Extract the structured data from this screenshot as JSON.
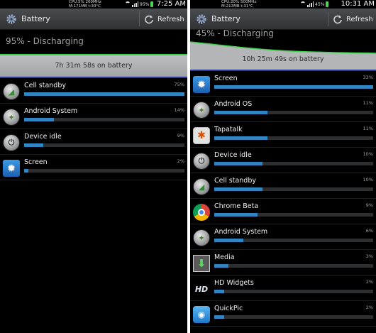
{
  "left": {
    "status": {
      "cpu_line1": "CPU:5% 200MHz",
      "cpu_line2": "M:171MB t:30°C",
      "battery_text": "95%",
      "time": "7:25 AM"
    },
    "actionbar": {
      "title": "Battery",
      "refresh_label": "Refresh"
    },
    "summary": "95% - Discharging",
    "graph_label": "7h 31m 58s on battery",
    "battery_level": 0.95,
    "items": [
      {
        "name": "Cell standby",
        "percent_text": "75%",
        "value": 75,
        "icon": "cell-signal-icon"
      },
      {
        "name": "Android System",
        "percent_text": "14%",
        "value": 14,
        "icon": "android-system-icon"
      },
      {
        "name": "Device idle",
        "percent_text": "9%",
        "value": 9,
        "icon": "power-icon"
      },
      {
        "name": "Screen",
        "percent_text": "2%",
        "value": 2,
        "icon": "brightness-icon"
      }
    ]
  },
  "right": {
    "status": {
      "cpu_line1": "CPU:20% 500MHz",
      "cpu_line2": "M:213MB t:31°C",
      "battery_text": "45%",
      "time": "10:31 AM"
    },
    "actionbar": {
      "title": "Battery",
      "refresh_label": "Refresh"
    },
    "summary": "45% - Discharging",
    "graph_label": "10h 25m 49s on battery",
    "battery_level": 0.45,
    "items": [
      {
        "name": "Screen",
        "percent_text": "33%",
        "value": 33,
        "icon": "brightness-icon"
      },
      {
        "name": "Android OS",
        "percent_text": "11%",
        "value": 11,
        "icon": "android-os-icon"
      },
      {
        "name": "Tapatalk",
        "percent_text": "11%",
        "value": 11,
        "icon": "tapatalk-icon"
      },
      {
        "name": "Device idle",
        "percent_text": "10%",
        "value": 10,
        "icon": "power-icon"
      },
      {
        "name": "Cell standby",
        "percent_text": "10%",
        "value": 10,
        "icon": "cell-signal-icon"
      },
      {
        "name": "Chrome Beta",
        "percent_text": "9%",
        "value": 9,
        "icon": "chrome-icon"
      },
      {
        "name": "Android System",
        "percent_text": "6%",
        "value": 6,
        "icon": "android-system-icon"
      },
      {
        "name": "Media",
        "percent_text": "3%",
        "value": 3,
        "icon": "media-download-icon"
      },
      {
        "name": "HD Widgets",
        "percent_text": "2%",
        "value": 2,
        "icon": "hd-widgets-icon"
      },
      {
        "name": "QuickPic",
        "percent_text": "2%",
        "value": 2,
        "icon": "quickpic-icon"
      }
    ]
  },
  "colors": {
    "usage_bar": "#2f86c2",
    "battery_green": "#3bd24a",
    "graph_bg": "#b3b5b7"
  }
}
